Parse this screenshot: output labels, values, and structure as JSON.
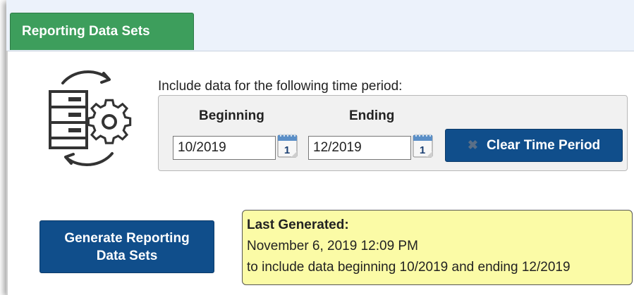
{
  "tab": {
    "label": "Reporting Data Sets"
  },
  "period": {
    "prompt": "Include data for the following time period:",
    "beginning_label": "Beginning",
    "ending_label": "Ending",
    "beginning_value": "10/2019",
    "ending_value": "12/2019",
    "calendar_day": "1",
    "clear_button": "Clear Time Period"
  },
  "generate_button": "Generate Reporting Data Sets",
  "last_generated": {
    "title": "Last Generated:",
    "timestamp": "November 6, 2019 12:09 PM",
    "note": "to include data beginning 10/2019 and ending 12/2019"
  },
  "colors": {
    "tab_green": "#3d9e5c",
    "button_blue": "#104e8b",
    "note_yellow": "#fbfba6"
  },
  "icons": [
    "database-sync-icon",
    "calendar-icon",
    "close-icon"
  ]
}
